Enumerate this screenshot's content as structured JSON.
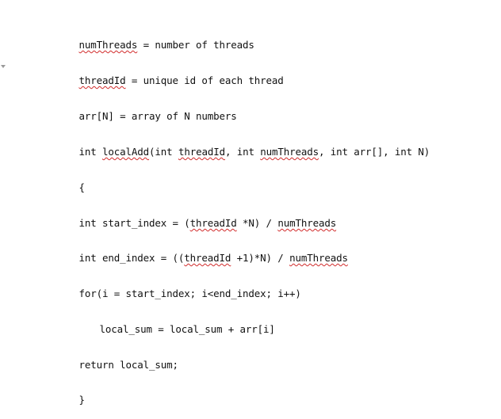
{
  "lines": [
    {
      "segments": [
        {
          "text": "numThreads",
          "spellcheck": true
        },
        {
          "text": " = number of threads",
          "spellcheck": false
        }
      ]
    },
    {
      "segments": [
        {
          "text": "threadId",
          "spellcheck": true
        },
        {
          "text": " = unique id of each thread",
          "spellcheck": false
        }
      ]
    },
    {
      "segments": [
        {
          "text": "arr[N] = array of N numbers",
          "spellcheck": false
        }
      ]
    },
    {
      "segments": [
        {
          "text": "int ",
          "spellcheck": false
        },
        {
          "text": "localAdd",
          "spellcheck": true
        },
        {
          "text": "(int ",
          "spellcheck": false
        },
        {
          "text": "threadId",
          "spellcheck": true
        },
        {
          "text": ", int ",
          "spellcheck": false
        },
        {
          "text": "numThreads",
          "spellcheck": true
        },
        {
          "text": ", int arr[], int N)",
          "spellcheck": false
        }
      ]
    },
    {
      "segments": [
        {
          "text": "{",
          "spellcheck": false
        }
      ]
    },
    {
      "segments": [
        {
          "text": "int start_index = (",
          "spellcheck": false
        },
        {
          "text": "threadId",
          "spellcheck": true
        },
        {
          "text": " *N) / ",
          "spellcheck": false
        },
        {
          "text": "numThreads",
          "spellcheck": true
        }
      ]
    },
    {
      "segments": [
        {
          "text": "int end_index = ((",
          "spellcheck": false
        },
        {
          "text": "threadId",
          "spellcheck": true
        },
        {
          "text": " +1)*N) / ",
          "spellcheck": false
        },
        {
          "text": "numThreads",
          "spellcheck": true
        }
      ]
    },
    {
      "segments": [
        {
          "text": "for(i = start_index; i<end_index; i++)",
          "spellcheck": false
        }
      ]
    },
    {
      "segments": [
        {
          "text": "local_sum = local_sum + arr[i]",
          "spellcheck": false
        }
      ]
    },
    {
      "segments": [
        {
          "text": "return local_sum;",
          "spellcheck": false
        }
      ]
    },
    {
      "segments": [
        {
          "text": "}",
          "spellcheck": false
        }
      ]
    }
  ],
  "colors": {
    "text": "#111111",
    "spellcheck_underline": "#d12b2b",
    "background": "#ffffff",
    "gutter_marker": "#9a9a9a"
  }
}
